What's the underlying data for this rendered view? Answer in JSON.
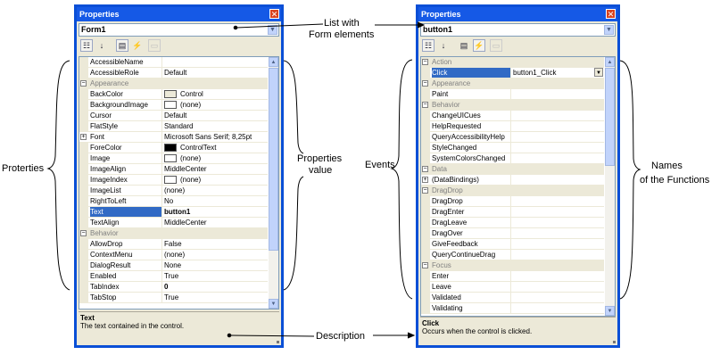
{
  "left": {
    "title": "Properties",
    "combo": "Form1",
    "rows": [
      {
        "name": "AccessibleName",
        "value": ""
      },
      {
        "name": "AccessibleRole",
        "value": "Default"
      },
      {
        "name": "Appearance",
        "cat": true
      },
      {
        "name": "BackColor",
        "value": "Control",
        "swatch": "#ece9d8"
      },
      {
        "name": "BackgroundImage",
        "value": "(none)",
        "swatch": "#ffffff"
      },
      {
        "name": "Cursor",
        "value": "Default"
      },
      {
        "name": "FlatStyle",
        "value": "Standard"
      },
      {
        "name": "Font",
        "value": "Microsoft Sans Serif; 8,25pt",
        "plus": true
      },
      {
        "name": "ForeColor",
        "value": "ControlText",
        "swatch": "#000000"
      },
      {
        "name": "Image",
        "value": "(none)",
        "swatch": "#ffffff"
      },
      {
        "name": "ImageAlign",
        "value": "MiddleCenter"
      },
      {
        "name": "ImageIndex",
        "value": "(none)",
        "swatch": "#ffffff"
      },
      {
        "name": "ImageList",
        "value": "(none)"
      },
      {
        "name": "RightToLeft",
        "value": "No"
      },
      {
        "name": "Text",
        "value": "button1",
        "sel": true,
        "bold": true
      },
      {
        "name": "TextAlign",
        "value": "MiddleCenter"
      },
      {
        "name": "Behavior",
        "cat": true
      },
      {
        "name": "AllowDrop",
        "value": "False"
      },
      {
        "name": "ContextMenu",
        "value": "(none)"
      },
      {
        "name": "DialogResult",
        "value": "None"
      },
      {
        "name": "Enabled",
        "value": "True"
      },
      {
        "name": "TabIndex",
        "value": "0",
        "bold": true
      },
      {
        "name": "TabStop",
        "value": "True"
      }
    ],
    "desc_title": "Text",
    "desc_text": "The text contained in the control."
  },
  "right": {
    "title": "Properties",
    "combo": "button1",
    "rows": [
      {
        "name": "Action",
        "cat": true
      },
      {
        "name": "Click",
        "value": "button1_Click",
        "sel": true,
        "dropdown": true
      },
      {
        "name": "Appearance",
        "cat": true
      },
      {
        "name": "Paint",
        "value": ""
      },
      {
        "name": "Behavior",
        "cat": true
      },
      {
        "name": "ChangeUICues",
        "value": ""
      },
      {
        "name": "HelpRequested",
        "value": ""
      },
      {
        "name": "QueryAccessibilityHelp",
        "value": ""
      },
      {
        "name": "StyleChanged",
        "value": ""
      },
      {
        "name": "SystemColorsChanged",
        "value": ""
      },
      {
        "name": "Data",
        "cat": true
      },
      {
        "name": "(DataBindings)",
        "value": "",
        "plus": true
      },
      {
        "name": "DragDrop",
        "cat": true
      },
      {
        "name": "DragDrop",
        "value": ""
      },
      {
        "name": "DragEnter",
        "value": ""
      },
      {
        "name": "DragLeave",
        "value": ""
      },
      {
        "name": "DragOver",
        "value": ""
      },
      {
        "name": "GiveFeedback",
        "value": ""
      },
      {
        "name": "QueryContinueDrag",
        "value": ""
      },
      {
        "name": "Focus",
        "cat": true
      },
      {
        "name": "Enter",
        "value": ""
      },
      {
        "name": "Leave",
        "value": ""
      },
      {
        "name": "Validated",
        "value": ""
      },
      {
        "name": "Validating",
        "value": ""
      }
    ],
    "desc_title": "Click",
    "desc_text": "Occurs when the control is clicked."
  },
  "annotations": {
    "list": "List with",
    "list2": "Form elements",
    "proterties": "Proterties",
    "props_value": "Properties",
    "props_value2": "value",
    "events": "Events",
    "names": "Names",
    "names2": "of the Functions",
    "description": "Description"
  },
  "colors": {
    "titlebar": "#1559e6",
    "selection": "#316ac5",
    "face": "#ece9d8"
  }
}
